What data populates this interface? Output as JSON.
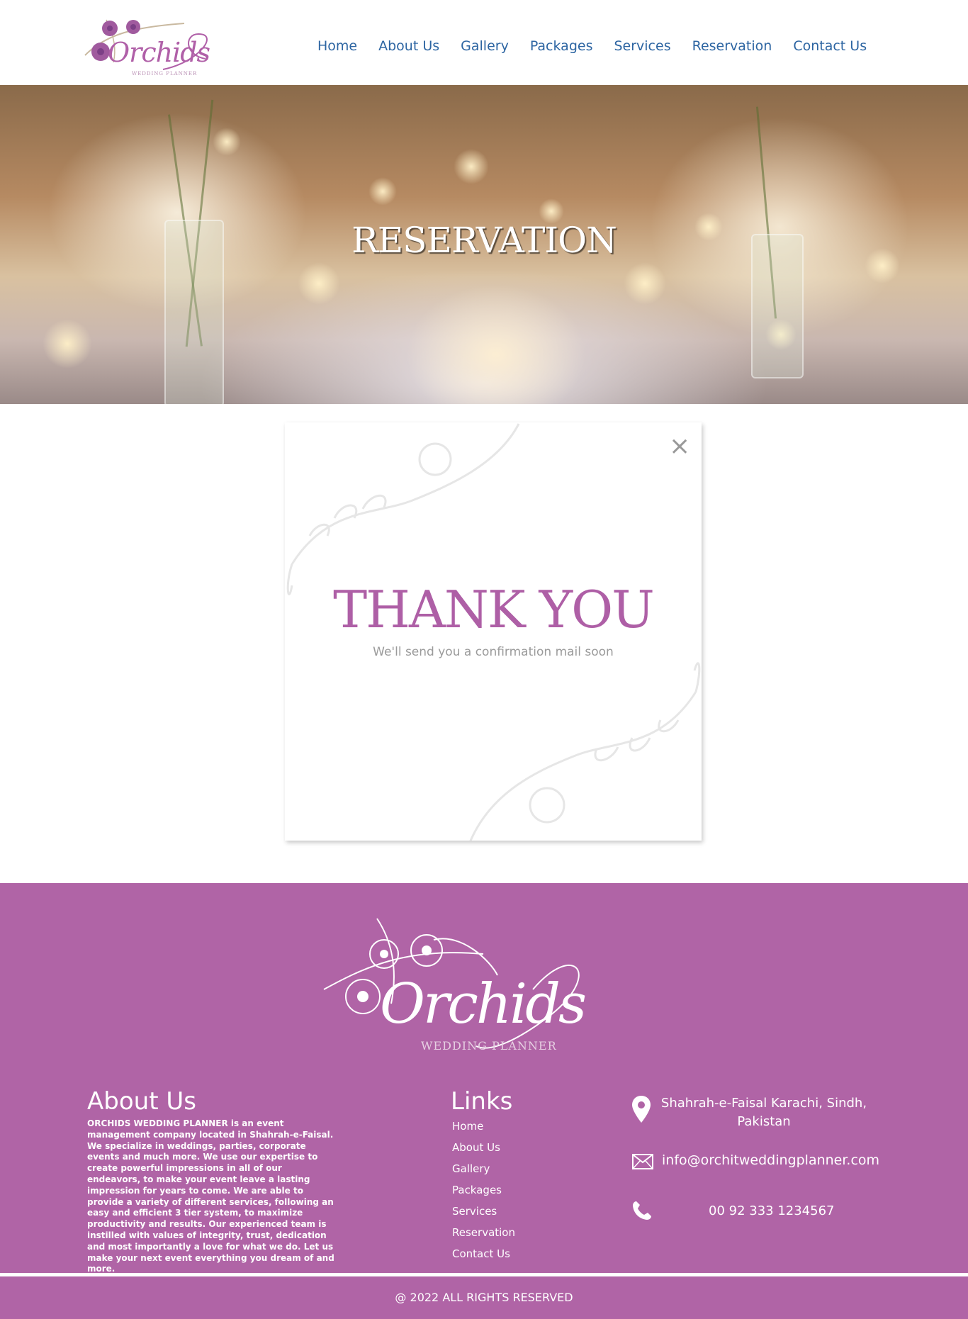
{
  "header": {
    "logo_text": "Orchids",
    "logo_sub": "WEDDING PLANNER",
    "nav": [
      {
        "label": "Home"
      },
      {
        "label": "About Us"
      },
      {
        "label": "Gallery"
      },
      {
        "label": "Packages"
      },
      {
        "label": "Services"
      },
      {
        "label": "Reservation"
      },
      {
        "label": "Contact Us"
      }
    ]
  },
  "hero": {
    "title": "RESERVATION"
  },
  "thank_you": {
    "close_label": "×",
    "heading": "THANK YOU",
    "message": "We'll send you a confirmation mail soon"
  },
  "footer": {
    "logo_text": "Orchids",
    "logo_sub": "WEDDING PLANNER",
    "about_title": "About Us",
    "about_text": "ORCHIDS WEDDING PLANNER is an event management company located in Shahrah-e-Faisal. We specialize in weddings, parties, corporate events and much more. We use our expertise to create powerful impressions in all of our endeavors, to make your event leave a lasting impression for years to come. We are able to provide a variety of different services, following an easy and efficient 3 tier system, to maximize productivity and results. Our experienced team is instilled with values of integrity, trust, dedication and most importantly a love for what we do. Let us make your next event everything you dream of and more.",
    "links_title": "Links",
    "links": [
      {
        "label": "Home"
      },
      {
        "label": "About Us"
      },
      {
        "label": "Gallery"
      },
      {
        "label": "Packages"
      },
      {
        "label": "Services"
      },
      {
        "label": "Reservation"
      },
      {
        "label": "Contact Us"
      }
    ],
    "address": "Shahrah-e-Faisal Karachi, Sindh, Pakistan",
    "email": "info@orchitweddingplanner.com",
    "phone": "00 92 333 1234567",
    "copyright": "@ 2022 ALL RIGHTS RESERVED"
  },
  "colors": {
    "brand_purple": "#b064a6",
    "nav_blue": "#2d65a2"
  }
}
